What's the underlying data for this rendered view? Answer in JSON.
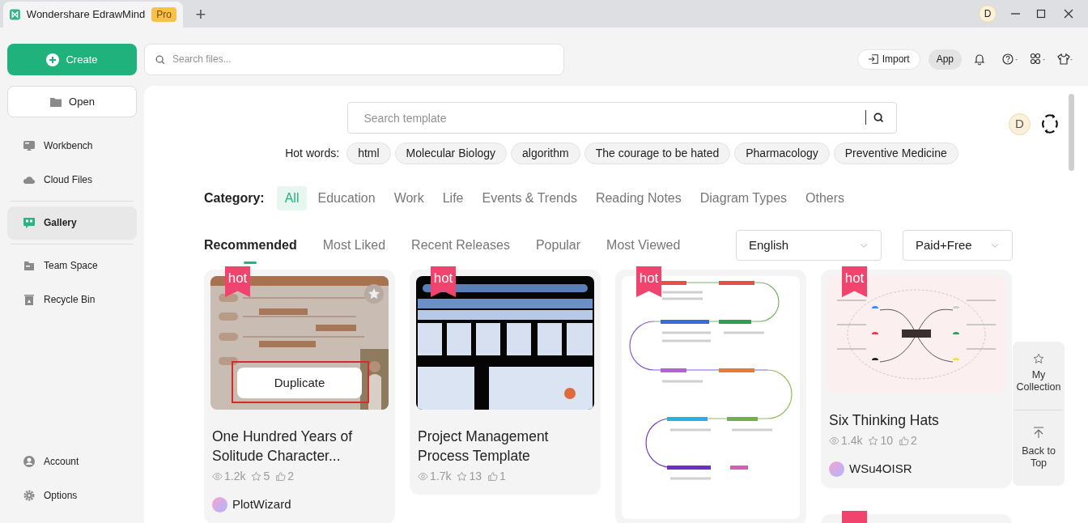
{
  "window": {
    "tab_title": "Wondershare EdrawMind",
    "plan_badge": "Pro",
    "new_tab": "+",
    "user_initial": "D"
  },
  "sidebar": {
    "create": "Create",
    "open": "Open",
    "items": [
      {
        "label": "Workbench",
        "kind": "workbench",
        "selected": false,
        "divider_above": false
      },
      {
        "label": "Cloud Files",
        "kind": "cloud",
        "selected": false,
        "divider_above": false
      },
      {
        "label": "Gallery",
        "kind": "gallery",
        "selected": true,
        "divider_above": true
      },
      {
        "label": "Team Space",
        "kind": "team",
        "selected": false,
        "divider_above": true
      },
      {
        "label": "Recycle Bin",
        "kind": "bin",
        "selected": false,
        "divider_above": false
      }
    ],
    "bottom_items": [
      {
        "label": "Account",
        "kind": "account"
      },
      {
        "label": "Options",
        "kind": "gear"
      }
    ]
  },
  "toolbar": {
    "search_placeholder": "Search files...",
    "import": "Import",
    "app": "App"
  },
  "gallery": {
    "search_placeholder": "Search template",
    "user_initial": "D",
    "hot_words_label": "Hot words:",
    "hot_words": [
      "html",
      "Molecular Biology",
      "algorithm",
      "The courage to be hated",
      "Pharmacology",
      "Preventive Medicine"
    ],
    "category_label": "Category:",
    "categories": [
      {
        "label": "All",
        "selected": true
      },
      {
        "label": "Education",
        "selected": false
      },
      {
        "label": "Work",
        "selected": false
      },
      {
        "label": "Life",
        "selected": false
      },
      {
        "label": "Events & Trends",
        "selected": false
      },
      {
        "label": "Reading Notes",
        "selected": false
      },
      {
        "label": "Diagram Types",
        "selected": false
      },
      {
        "label": "Others",
        "selected": false
      }
    ],
    "sort_tabs": [
      {
        "label": "Recommended",
        "selected": true
      },
      {
        "label": "Most Liked",
        "selected": false
      },
      {
        "label": "Recent Releases",
        "selected": false
      },
      {
        "label": "Popular",
        "selected": false
      },
      {
        "label": "Most Viewed",
        "selected": false
      }
    ],
    "language": "English",
    "price": "Paid+Free",
    "columns": [
      [
        {
          "badge": "hot",
          "kind": "org-chart",
          "hover_button": "Duplicate",
          "highlighted": true,
          "title": "One Hundred Years of Solitude Character...",
          "views": "1.2k",
          "stars": "5",
          "likes": "2",
          "author": "PlotWizard"
        }
      ],
      [
        {
          "badge": "hot",
          "kind": "process",
          "title": "Project Management Process Template",
          "views": "1.7k",
          "stars": "13",
          "likes": "1"
        }
      ],
      [
        {
          "badge": "hot",
          "kind": "roadmap"
        }
      ],
      [
        {
          "badge": "hot",
          "kind": "mind-map",
          "title": "Six Thinking Hats",
          "views": "1.4k",
          "stars": "10",
          "likes": "2",
          "author": "WSu4OISR"
        },
        {
          "kind": "ribbon-only"
        }
      ]
    ],
    "float_panel": {
      "collection": "My Collection",
      "back_to_top": "Back to Top"
    }
  }
}
